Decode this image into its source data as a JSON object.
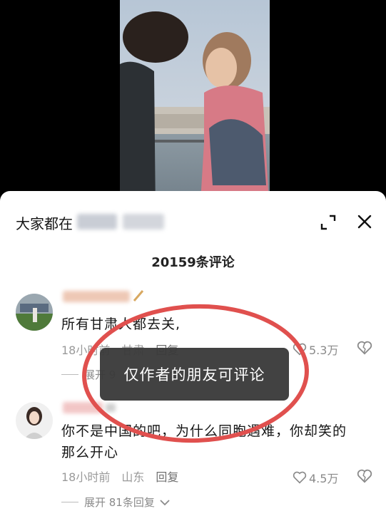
{
  "panel": {
    "title_prefix": "大家都在",
    "expand_icon": "expand-icon",
    "close_icon": "close-icon"
  },
  "comment_count": "20159条评论",
  "comments": [
    {
      "text": "所有甘肃人都去关,",
      "time": "18小时前",
      "location": "甘肃",
      "reply": "回复",
      "likes": "5.3万",
      "expand": "展开 9"
    },
    {
      "text_line1": "你不是中国的吧，为什么同胞遇难，你却笑的",
      "text_line2": "那么开心",
      "time": "18小时前",
      "location": "山东",
      "reply": "回复",
      "likes": "4.5万",
      "expand": "展开 81条回复"
    }
  ],
  "toast": "仅作者的朋友可评论",
  "colors": {
    "toast_bg": "#3a3a3a",
    "annotation_red": "#e0504e",
    "meta_gray": "#9a9a9a"
  }
}
